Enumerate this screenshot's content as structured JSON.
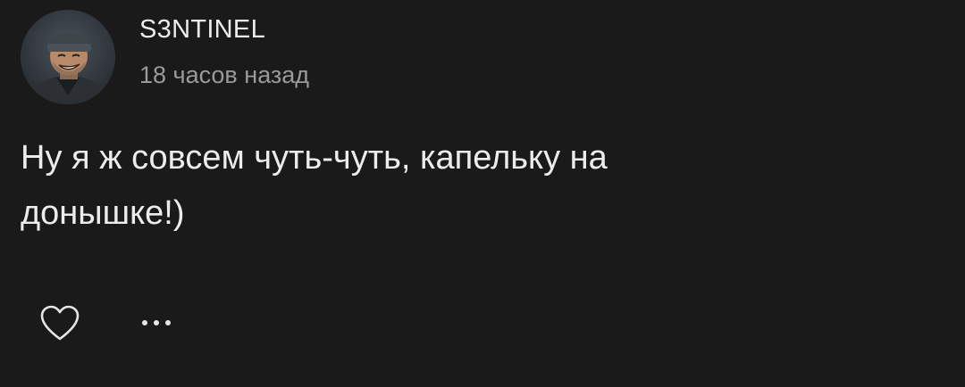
{
  "comment": {
    "author": "S3NTINEL",
    "timestamp": "18 часов назад",
    "text": "Ну я ж совсем чуть-чуть, капельку на донышке!)",
    "avatar_icon": "user-avatar-illustration"
  },
  "actions": {
    "like_icon": "heart-outline-icon",
    "more_icon": "more-horizontal-icon"
  },
  "colors": {
    "background": "#1a1a1b",
    "primary_text": "#ececec",
    "secondary_text": "#9a9a9a"
  }
}
